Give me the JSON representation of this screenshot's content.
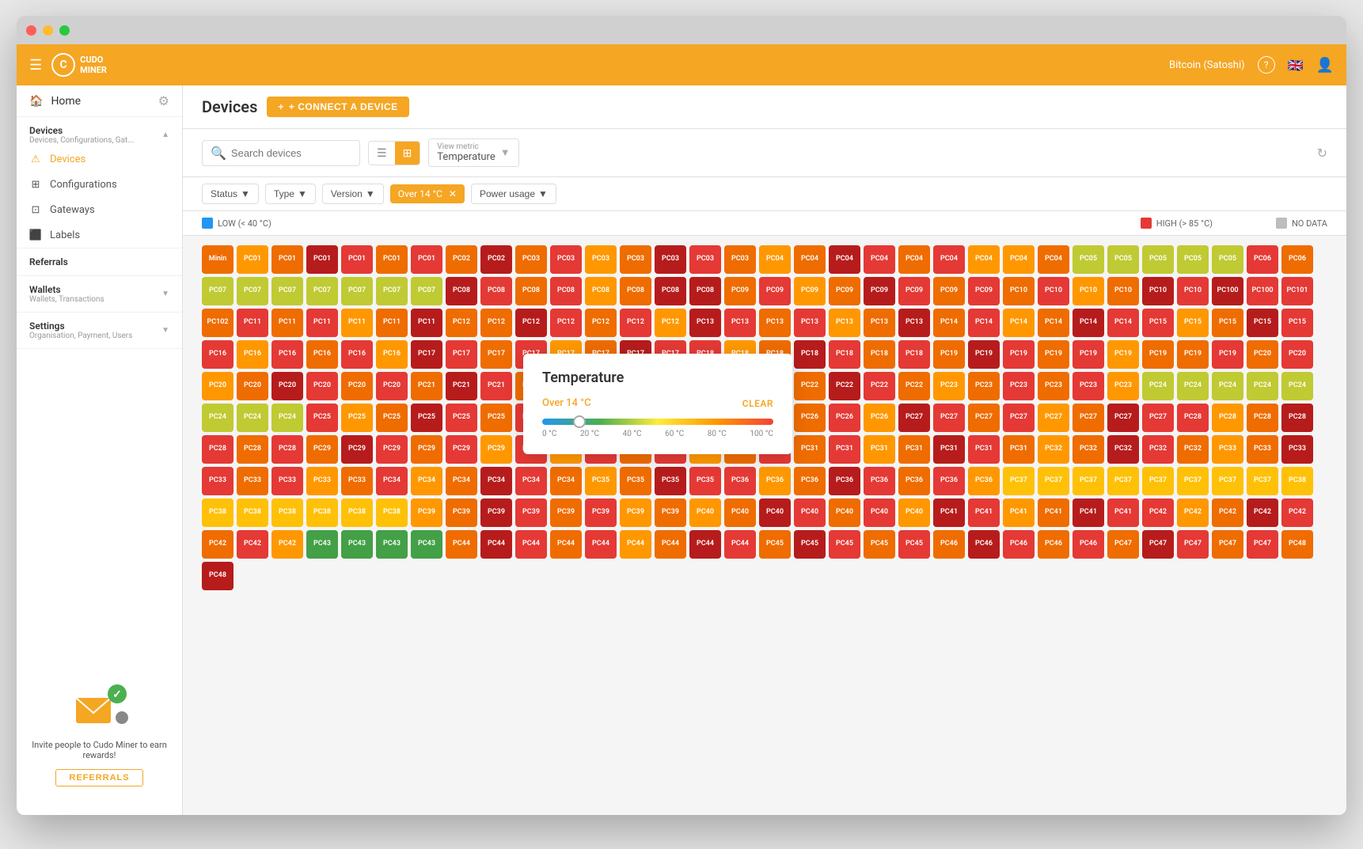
{
  "window": {
    "title": "Cudo Miner"
  },
  "topnav": {
    "hamburger_label": "☰",
    "logo_text": "CUDO\nMINER",
    "currency": "Bitcoin (Satoshi)",
    "help_icon": "?",
    "language": "🇬🇧",
    "user_icon": "👤"
  },
  "sidebar": {
    "home_label": "Home",
    "home_icon": "🏠",
    "gear_icon": "⚙",
    "devices_section": {
      "title": "Devices",
      "subtitle": "Devices, Configurations, Gat...",
      "chevron": "▲",
      "items": [
        {
          "label": "Devices",
          "icon": "⚠",
          "active": true
        },
        {
          "label": "Configurations",
          "icon": "⊞"
        },
        {
          "label": "Gateways",
          "icon": "⊡"
        },
        {
          "label": "Labels",
          "icon": "⬛"
        }
      ]
    },
    "referrals_label": "Referrals",
    "wallets_section": {
      "title": "Wallets",
      "subtitle": "Wallets, Transactions",
      "chevron": "▼"
    },
    "settings_section": {
      "title": "Settings",
      "subtitle": "Organisation, Payment, Users",
      "chevron": "▼"
    },
    "referral_promo": "Invite people to Cudo Miner to earn rewards!",
    "referral_btn": "REFERRALS"
  },
  "content": {
    "page_title": "Devices",
    "connect_btn": "+ CONNECT A DEVICE",
    "search_placeholder": "Search devices",
    "view_metric_label": "View metric",
    "view_metric_value": "Temperature",
    "filters": {
      "status_label": "Status",
      "type_label": "Type",
      "version_label": "Version",
      "active_filter": "Over 14 °C",
      "power_usage_label": "Power usage"
    },
    "legend": {
      "low_label": "LOW (< 40 °C)",
      "high_label": "HIGH (> 85 °C)",
      "no_data_label": "NO DATA",
      "low_color": "#2196f3",
      "high_color": "#e53935",
      "no_data_color": "#bdbdbd"
    },
    "popup": {
      "title": "Temperature",
      "filter_label": "Over 14 °C",
      "clear_label": "CLEAR",
      "temp_labels": [
        "0 °C",
        "20 °C",
        "40 °C",
        "60 °C",
        "80 °C",
        "100 °C"
      ],
      "slider_position_pct": 16
    }
  },
  "devices": {
    "colors": [
      "c-red",
      "c-orange",
      "c-orange-light",
      "c-yellow",
      "c-yellow-green",
      "c-green",
      "c-dark-red",
      "c-pink-red",
      "c-orange",
      "c-red",
      "c-orange-light",
      "c-yellow",
      "c-green-bright",
      "c-gray"
    ],
    "rows": [
      [
        "Minin",
        "PC01",
        "PC01",
        "PC01",
        "PC01",
        "PC01",
        "PC01",
        "PC02",
        "PC02",
        "PC03",
        "PC03",
        "PC03",
        "PC03",
        "PC03",
        "PC03",
        "PC03",
        "PC04",
        "PC04",
        "PC04",
        "PC04",
        "PC04",
        "PC04",
        "PC04"
      ],
      [
        "PC04",
        "PC04",
        "PC05",
        "PC05",
        "PC05",
        "PC05",
        "PC05",
        "PC06",
        "PC06",
        "PC07",
        "PC07",
        "PC07",
        "PC07",
        "PC07",
        "PC07",
        "PC07",
        "PC08",
        "PC08",
        "PC08",
        "PC08",
        "PC08",
        "PC08",
        "PC08"
      ],
      [
        "PC08",
        "PC09",
        "PC09",
        "PC09",
        "PC09",
        "PC09",
        "PC09",
        "PC09",
        "PC09",
        "PC10",
        "PC10",
        "PC10",
        "PC10",
        "PC10",
        "PC10",
        "PC100",
        "PC100",
        "PC101",
        "PC102",
        "PC11",
        "PC11",
        "PC11",
        "PC11",
        "PC11",
        "PC11",
        "PC12"
      ],
      [
        "PC12",
        "PC12",
        "PC12",
        "PC12",
        "PC12",
        "PC12",
        "PC13",
        "PC13",
        "PC13",
        "PC13",
        "PC13",
        "PC13",
        "PC13",
        "PC14",
        "PC14",
        "PC14",
        "PC14",
        "PC14",
        "PC14",
        "PC15",
        "PC15",
        "PC15",
        "PC15",
        "PC15",
        "PC16",
        "PC16"
      ],
      [
        "PC16",
        "PC16",
        "PC16",
        "PC16",
        "PC17",
        "PC17",
        "PC17",
        "PC17",
        "PC17",
        "PC17",
        "PC17",
        "PC17",
        "PC18",
        "PC18",
        "PC18",
        "PC18",
        "PC18",
        "PC18",
        "PC18",
        "PC19",
        "PC19",
        "PC19",
        "PC19",
        "PC19",
        "PC19",
        "PC19"
      ],
      [
        "PC19",
        "PC19",
        "PC20",
        "PC20",
        "PC20",
        "PC20",
        "PC20",
        "PC20",
        "PC20",
        "PC20",
        "PC21",
        "PC21",
        "PC21",
        "PC21",
        "PC21",
        "PC31",
        "PC21",
        "PC21",
        "PC22",
        "PC22",
        "PC22",
        "PC22",
        "PC22",
        "PC22",
        "PC22",
        "PC23",
        "PC23"
      ],
      [
        "PC23",
        "PC23",
        "PC23",
        "PC23",
        "PC24",
        "PC24",
        "PC24",
        "PC24",
        "PC24",
        "PC24",
        "PC24",
        "PC24",
        "PC25",
        "PC25",
        "PC25",
        "PC25",
        "PC25",
        "PC25",
        "PC25",
        "PC25",
        "PC26",
        "PC26",
        "PC26",
        "PC26",
        "PC26",
        "PC26"
      ],
      [
        "PC26",
        "PC26",
        "PC26",
        "PC27",
        "PC27",
        "PC27",
        "PC27",
        "PC27",
        "PC27",
        "PC27",
        "PC27",
        "PC28",
        "PC28",
        "PC28",
        "PC28",
        "PC28",
        "PC28",
        "PC28",
        "PC29",
        "PC29",
        "PC29",
        "PC29",
        "PC29",
        "PC29",
        "PC30",
        "PC30"
      ],
      [
        "PC30",
        "PC30",
        "PC30",
        "PC30",
        "PC30",
        "PC31",
        "PC31",
        "PC31",
        "PC31",
        "PC31",
        "PC31",
        "PC31",
        "PC31",
        "PC32",
        "PC32",
        "PC32",
        "PC32",
        "PC32",
        "PC33",
        "PC33",
        "PC33",
        "PC33",
        "PC33",
        "PC33",
        "PC33",
        "PC33"
      ],
      [
        "PC34",
        "PC34",
        "PC34",
        "PC34",
        "PC34",
        "PC34",
        "PC35",
        "PC35",
        "PC35",
        "PC35",
        "PC36",
        "PC36",
        "PC36",
        "PC36",
        "PC36",
        "PC36",
        "PC36",
        "PC36",
        "PC37",
        "PC37",
        "PC37",
        "PC37",
        "PC37"
      ],
      [
        "PC37",
        "PC37",
        "PC37",
        "PC38",
        "PC38",
        "PC38",
        "PC38",
        "PC38",
        "PC38",
        "PC38",
        "PC39",
        "PC39",
        "PC39",
        "PC39",
        "PC39",
        "PC39",
        "PC39",
        "PC39",
        "PC40",
        "PC40",
        "PC40",
        "PC40",
        "PC40",
        "PC40",
        "PC40",
        "PC41"
      ],
      [
        "PC41",
        "PC41",
        "PC41",
        "PC41",
        "PC41",
        "PC42",
        "PC42",
        "PC42",
        "PC42",
        "PC42",
        "PC42",
        "PC42",
        "PC42",
        "PC43",
        "PC43",
        "PC43",
        "PC43",
        "PC44",
        "PC44",
        "PC44",
        "PC44",
        "PC44",
        "PC44",
        "PC44",
        "PC44",
        "PC44"
      ],
      [
        "PC45",
        "PC45",
        "PC45",
        "PC45",
        "PC45",
        "PC46",
        "PC46",
        "PC46",
        "PC46",
        "PC46",
        "PC47",
        "PC47",
        "PC47",
        "PC47",
        "PC47",
        "PC48",
        "PC48"
      ]
    ]
  }
}
